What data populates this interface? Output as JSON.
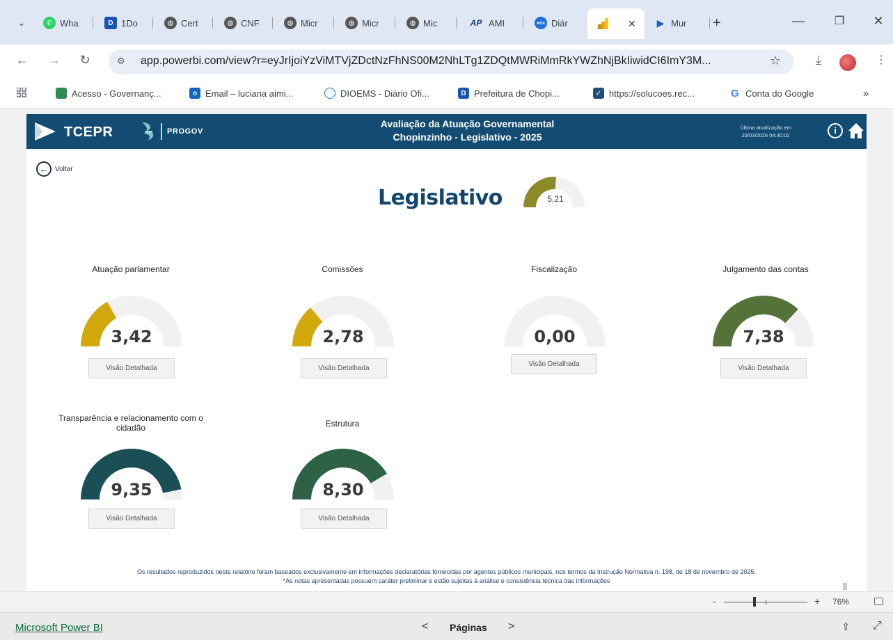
{
  "browser": {
    "tabs": [
      {
        "label": "Wha",
        "icon": "whatsapp-icon",
        "color": "#25d366"
      },
      {
        "label": "1Do",
        "icon": "d-icon",
        "color": "#1a53b5"
      },
      {
        "label": "Cert",
        "icon": "globe-icon",
        "color": "#444444"
      },
      {
        "label": "CNF",
        "icon": "globe-icon",
        "color": "#444444"
      },
      {
        "label": "Micr",
        "icon": "globe-icon",
        "color": "#444444"
      },
      {
        "label": "Micr",
        "icon": "globe-icon",
        "color": "#444444"
      },
      {
        "label": "Mic",
        "icon": "globe-icon",
        "color": "#444444"
      },
      {
        "label": "AMI",
        "icon": "amp-icon",
        "color": "#1a3a7a"
      },
      {
        "label": "Diár",
        "icon": "vox-icon",
        "color": "#1e6fd9"
      },
      {
        "label": "",
        "icon": "powerbi-icon",
        "color": "#f2c811"
      },
      {
        "label": "Mur",
        "icon": "play-icon",
        "color": "#1e5fbf"
      }
    ],
    "close_glyph": "✕",
    "new_tab_glyph": "+",
    "window_controls": {
      "minimize": "—",
      "restore": "❐",
      "close": "✕"
    },
    "url": "app.powerbi.com/view?r=eyJrIjoiYzViMTVjZDctNzFhNS00M2NhLTg1ZDQtMWRiMmRkYWZhNjBkIiwidCI6ImY3M...",
    "bookmarks": [
      {
        "label": "Acesso - Governanç...",
        "icon": "folder-icon"
      },
      {
        "label": "Email – luciana aimi...",
        "icon": "outlook-icon"
      },
      {
        "label": "DIOEMS - Diário Ofi...",
        "icon": "circle-icon"
      },
      {
        "label": "Prefeitura de Chopi...",
        "icon": "d-icon"
      },
      {
        "label": "https://solucoes.rec...",
        "icon": "receita-icon"
      },
      {
        "label": "Conta do Google",
        "icon": "google-icon"
      }
    ],
    "bookmarks_overflow": "»"
  },
  "report": {
    "header": {
      "brand": "TCEPR",
      "partner": "PROGOV",
      "title_line1": "Avaliação da Atuação Governamental",
      "title_line2": "Chopinzinho - Legislativo - 2025",
      "update_label": "Última atualização em",
      "update_value": "23/03/2026 04:30:02"
    },
    "back_label": "Voltar",
    "main": {
      "title": "Legislativo",
      "score_label": "5,21",
      "score": 5.21,
      "color": "#8c8a2a"
    },
    "detail_label": "Visão Detalhada",
    "cards": [
      {
        "title": "Atuação parlamentar",
        "value_label": "3,42",
        "value": 3.42,
        "color": "#d1a90c"
      },
      {
        "title": "Comissões",
        "value_label": "2,78",
        "value": 2.78,
        "color": "#d1a90c"
      },
      {
        "title": "Fiscalização",
        "value_label": "0,00",
        "value": 0.0,
        "color": "#d1a90c"
      },
      {
        "title": "Julgamento das contas",
        "value_label": "7,38",
        "value": 7.38,
        "color": "#547339"
      },
      {
        "title": "Transparência e relacionamento com o cidadão",
        "value_label": "9,35",
        "value": 9.35,
        "color": "#1b4f56"
      },
      {
        "title": "Estrutura",
        "value_label": "8,30",
        "value": 8.3,
        "color": "#2f6147"
      }
    ],
    "gauge_max": 10,
    "gauge_track_color": "#f1f1f1",
    "footnote_line1": "Os resultados reproduzidos neste relatório foram baseados exclusivamente em informações declaratórias fornecidas por agentes públicos municipais, nos termos da Instrução Normativa n. 198, de 18 de novembro de 2025.",
    "footnote_line2": "*As notas apresentadas possuem caráter preliminar e estão sujeitas à análise e consistência técnica das informações"
  },
  "zoom": {
    "minus": "-",
    "plus": "+",
    "percent_label": "76%",
    "percent": 76
  },
  "footer": {
    "link": "Microsoft Power BI",
    "prev": "<",
    "pages_label": "Páginas",
    "next": ">"
  }
}
